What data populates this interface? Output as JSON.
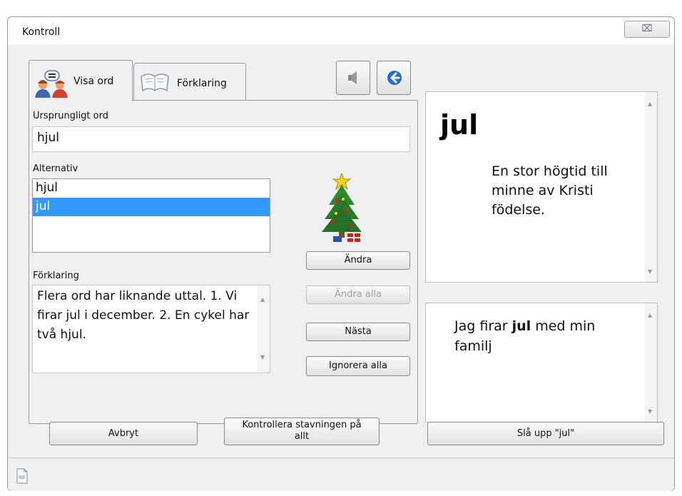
{
  "window": {
    "title": "Kontroll",
    "close_glyph": "⌧"
  },
  "tabs": [
    {
      "label": "Visa ord",
      "icon": "people-talking-icon",
      "active": true
    },
    {
      "label": "Förklaring",
      "icon": "open-book-icon",
      "active": false
    }
  ],
  "toolbar": {
    "speaker_icon": "speaker-icon",
    "back_icon": "back-arrow-icon"
  },
  "original_word": {
    "label": "Ursprungligt ord",
    "value": "hjul"
  },
  "alternatives": {
    "label": "Alternativ",
    "items": [
      "hjul",
      "jul"
    ],
    "selected_index": 1
  },
  "explanation": {
    "label": "Förklaring",
    "text": "Flera ord har liknande uttal. 1. Vi firar jul i december. 2. En cykel har två hjul."
  },
  "buttons": {
    "andra": "Ändra",
    "andra_alla": "Ändra alla",
    "nasta": "Nästa",
    "ignorera_alla": "Ignorera alla",
    "avbryt": "Avbryt",
    "kontrollera_line1": "Kontrollera stavningen på",
    "kontrollera_line2": "allt",
    "sla_upp": "Slå upp \"jul\""
  },
  "definition": {
    "word": "jul",
    "text": "En stor högtid till minne av Kristi födelse."
  },
  "example": {
    "before": "Jag firar ",
    "bold": "jul",
    "after": " med min familj"
  },
  "colors": {
    "selection": "#3399ff",
    "accent_blue": "#1f6fd0"
  }
}
